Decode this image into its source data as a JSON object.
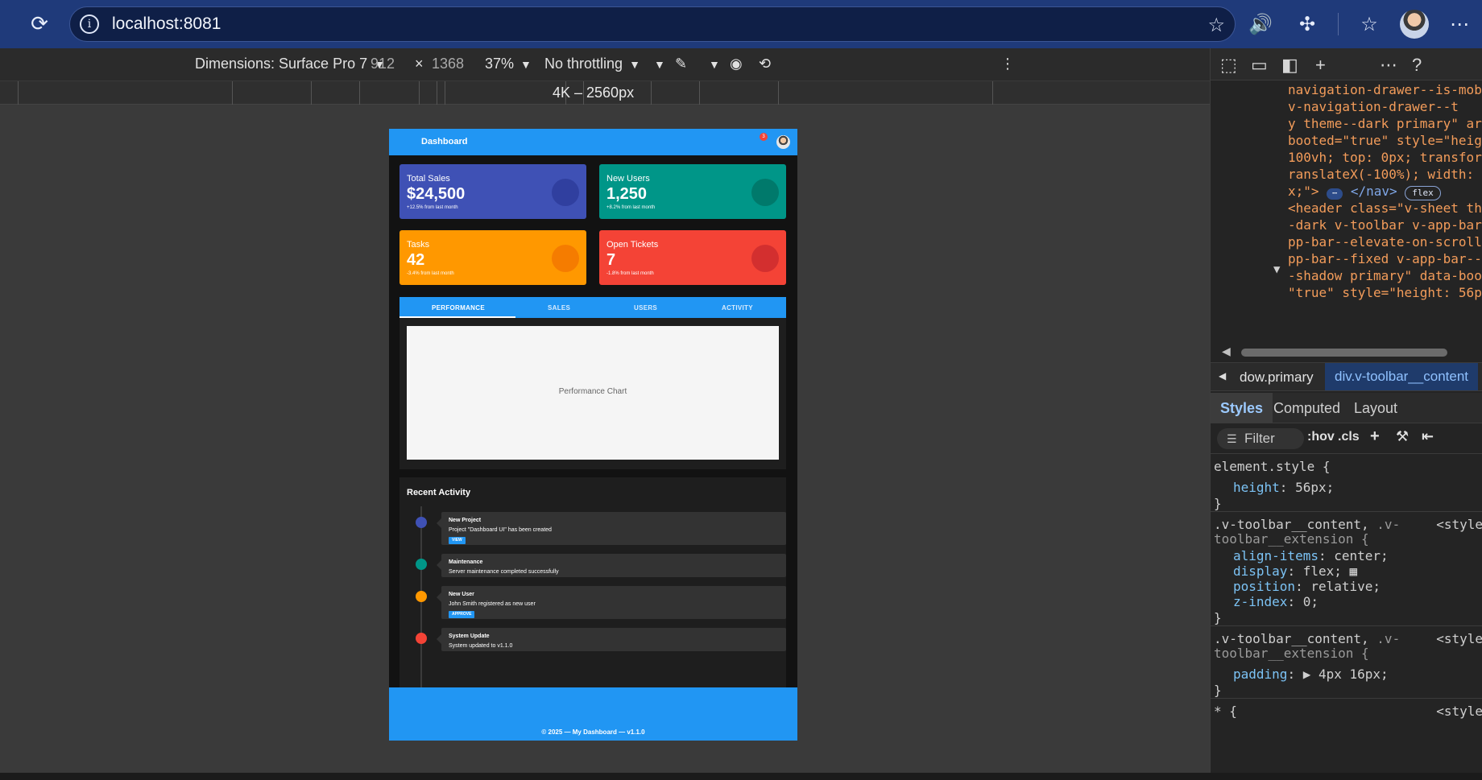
{
  "browser": {
    "url": "localhost:8081"
  },
  "device_toolbar": {
    "dimensions_label": "Dimensions: Surface Pro 7",
    "width": "912",
    "times": "×",
    "height": "1368",
    "zoom": "37%",
    "throttling": "No throttling",
    "ruler_label": "4K – 2560px"
  },
  "app": {
    "title": "Dashboard",
    "notification_count": "3",
    "stats": [
      {
        "label": "Total Sales",
        "value": "$24,500",
        "sub": "+12.5% from last month",
        "color": "#3f51b5",
        "bubble": "#303f9f"
      },
      {
        "label": "New Users",
        "value": "1,250",
        "sub": "+8.2% from last month",
        "color": "#009688",
        "bubble": "#00796b"
      },
      {
        "label": "Tasks",
        "value": "42",
        "sub": "-3.4% from last month",
        "color": "#ff9800",
        "bubble": "#f57c00"
      },
      {
        "label": "Open Tickets",
        "value": "7",
        "sub": "-1.8% from last month",
        "color": "#f44336",
        "bubble": "#d32f2f"
      }
    ],
    "tabs": [
      "PERFORMANCE",
      "SALES",
      "USERS",
      "ACTIVITY"
    ],
    "chart_placeholder": "Performance Chart",
    "recent_activity_title": "Recent Activity",
    "activities": [
      {
        "title": "New Project",
        "desc": "Project \"Dashboard UI\" has been created",
        "button": "VIEW",
        "color": "#3f51b5"
      },
      {
        "title": "Maintenance",
        "desc": "Server maintenance completed successfully",
        "button": "",
        "color": "#009688"
      },
      {
        "title": "New User",
        "desc": "John Smith registered as new user",
        "button": "APPROVE",
        "color": "#ff9800"
      },
      {
        "title": "System Update",
        "desc": "System updated to v1.1.0",
        "button": "",
        "color": "#f44336"
      }
    ],
    "footer": "© 2025 — My Dashboard — v1.1.0"
  },
  "devtools": {
    "dom_lines": [
      "navigation-drawer--is-mob",
      "v-navigation-drawer--t",
      "y theme--dark primary\" ar",
      "booted=\"true\" style=\"heig",
      "100vh; top: 0px; transfor",
      "ranslateX(-100%); width:",
      "x;\">",
      "</nav>",
      "flex",
      "<header class=\"v-sheet th",
      "-dark v-toolbar v-app-bar",
      "pp-bar--elevate-on-scroll",
      "pp-bar--fixed v-app-bar--",
      "-shadow primary\" data-boo",
      "\"true\" style=\"height: 56p"
    ],
    "breadcrumb_prev": "dow.primary",
    "breadcrumb_current": "div.v-toolbar__content",
    "styles_tabs": [
      "Styles",
      "Computed",
      "Layout"
    ],
    "filter_placeholder": "Filter",
    "filter_hov": ":hov",
    "filter_cls": ".cls",
    "rules": {
      "element_style": "element.style {",
      "height_prop": "height",
      "height_val": "56px;",
      "close": "}",
      "rule2_sel_a": ".v-toolbar__content,",
      "rule2_sel_b": ".v-",
      "rule2_sel_c": "toolbar__extension {",
      "rule2_src": "<style",
      "align_prop": "align-items",
      "align_val": "center;",
      "display_prop": "display",
      "display_val": "flex;",
      "position_prop": "position",
      "position_val": "relative;",
      "z_prop": "z-index",
      "z_val": "0;",
      "padding_prop": "padding",
      "padding_val": "4px 16px;",
      "star_sel": "* {"
    }
  }
}
